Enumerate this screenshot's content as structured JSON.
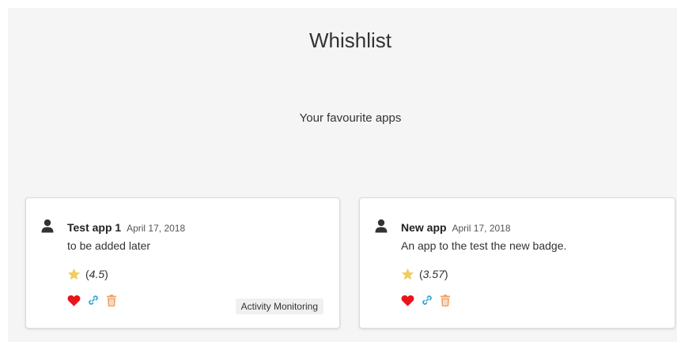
{
  "page": {
    "title": "Whishlist",
    "subtitle": "Your favourite apps"
  },
  "colors": {
    "heart": "#e8141a",
    "link": "#2fa6d8",
    "trash": "#f0a46a",
    "star": "#f1cc5e",
    "user": "#333333"
  },
  "apps": [
    {
      "name": "Test app 1",
      "date": "April 17, 2018",
      "description": "to be added later",
      "rating_text": "4.5",
      "tag": "Activity Monitoring",
      "icons": [
        "user-icon",
        "star-icon",
        "heart-icon",
        "link-icon",
        "trash-icon"
      ]
    },
    {
      "name": "New app",
      "date": "April 17, 2018",
      "description": "An app to the test the new badge.",
      "rating_text": "3.57",
      "icons": [
        "user-icon",
        "star-icon",
        "heart-icon",
        "link-icon",
        "trash-icon"
      ]
    }
  ]
}
